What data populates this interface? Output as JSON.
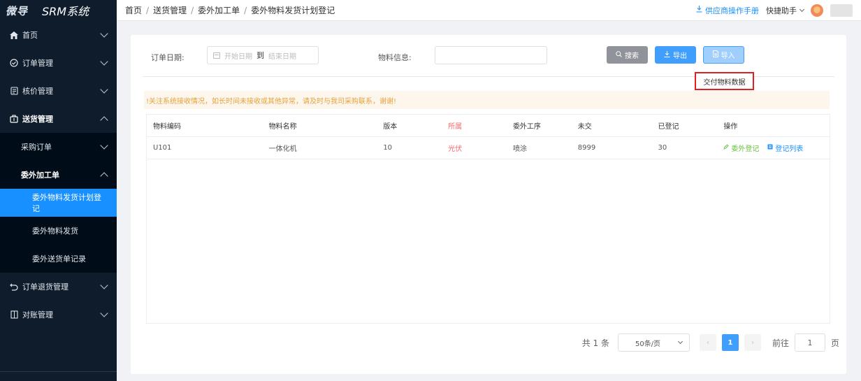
{
  "sidebar": {
    "brand": "微导",
    "system_name": "SRM系统",
    "items": [
      {
        "label": "首页",
        "icon": "home-icon"
      },
      {
        "label": "订单管理",
        "icon": "check-circle-icon"
      },
      {
        "label": "核价管理",
        "icon": "receipt-icon"
      },
      {
        "label": "送货管理",
        "icon": "box-icon"
      },
      {
        "label": "采购订单"
      },
      {
        "label": "委外加工单"
      },
      {
        "label": "委外物料发货计划登记"
      },
      {
        "label": "委外物料发货"
      },
      {
        "label": "委外送货单记录"
      },
      {
        "label": "订单退货管理",
        "icon": "return-icon"
      },
      {
        "label": "对账管理",
        "icon": "columns-icon"
      }
    ]
  },
  "header": {
    "breadcrumb": [
      "首页",
      "送货管理",
      "委外加工单",
      "委外物料发货计划登记"
    ],
    "manual_link": "供应商操作手册",
    "quick_help": "快捷助手"
  },
  "filters": {
    "order_date_label": "订单日期:",
    "start_placeholder": "开始日期",
    "to": "到",
    "end_placeholder": "结束日期",
    "material_label": "物料信息:",
    "material_value": "",
    "search_btn": "搜索",
    "export_btn": "导出",
    "import_btn": "导入"
  },
  "dropdown": {
    "item": "交付物料数据"
  },
  "notice": "!关注系统接收情况，如长时间未接收或其他异常，请及时与我司采购联系，谢谢!",
  "table": {
    "columns": [
      "物料编码",
      "物料名称",
      "版本",
      "所属",
      "委外工序",
      "未交",
      "已登记",
      "操作"
    ],
    "rows": [
      {
        "code": "U101",
        "name": "一体化机",
        "version": "10",
        "belong": "光伏",
        "process": "喷涂",
        "undelivered": "8999",
        "registered": "30",
        "op_register": "委外登记",
        "op_list": "登记列表"
      }
    ]
  },
  "pagination": {
    "total": "共 1 条",
    "page_size": "50条/页",
    "current_page": "1",
    "goto": "前往",
    "goto_value": "1",
    "page_unit": "页"
  },
  "colors": {
    "sidebar_bg": "#0e1c2b",
    "primary": "#409eff",
    "highlight_border": "#e02020",
    "notice_text": "#e6a23c"
  }
}
